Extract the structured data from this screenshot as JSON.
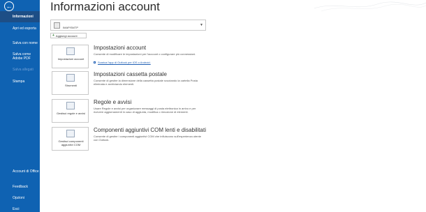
{
  "sidebar": {
    "items": [
      {
        "label": "Informazioni",
        "active": true
      },
      {
        "label": "Apri ed esporta"
      },
      {
        "label": "Salva con nome"
      },
      {
        "label": "Salva come Adobe PDF"
      },
      {
        "label": "Salva allegati",
        "disabled": true
      },
      {
        "label": "Stampa"
      },
      {
        "label": "Account di Office"
      },
      {
        "label": "Feedback"
      },
      {
        "label": "Opzioni"
      },
      {
        "label": "Esci"
      }
    ]
  },
  "main": {
    "title": "Informazioni account",
    "account_selector": {
      "value": "IMAP/SMTP"
    },
    "add_account_label": "Aggiungi account",
    "sections": [
      {
        "tile_label": "Impostazioni account",
        "title": "Impostazioni account",
        "description": "Consente di modificare le impostazioni per l'account o configurare più connessioni.",
        "link": "Scarica l'app di Outlook per iOS o Android."
      },
      {
        "tile_label": "Strumenti",
        "title": "Impostazioni cassetta postale",
        "description": "Consente di gestire la dimensione della cassetta postale svuotando la cartella Posta eliminata e archiviando elementi."
      },
      {
        "tile_label": "Gestisci regole e avvisi",
        "title": "Regole e avvisi",
        "description": "Usare Regole e avvisi per organizzare messaggi di posta elettronica in arrivo e per ricevere aggiornamenti in caso di aggiunta, modifica o rimozione di elementi."
      },
      {
        "tile_label": "Gestisci componenti aggiuntivi COM",
        "title": "Componenti aggiuntivi COM lenti e disabilitati",
        "description": "Consente di gestire i componenti aggiuntivi COM che influiscono sull'esperienza utente con Outlook."
      }
    ]
  }
}
